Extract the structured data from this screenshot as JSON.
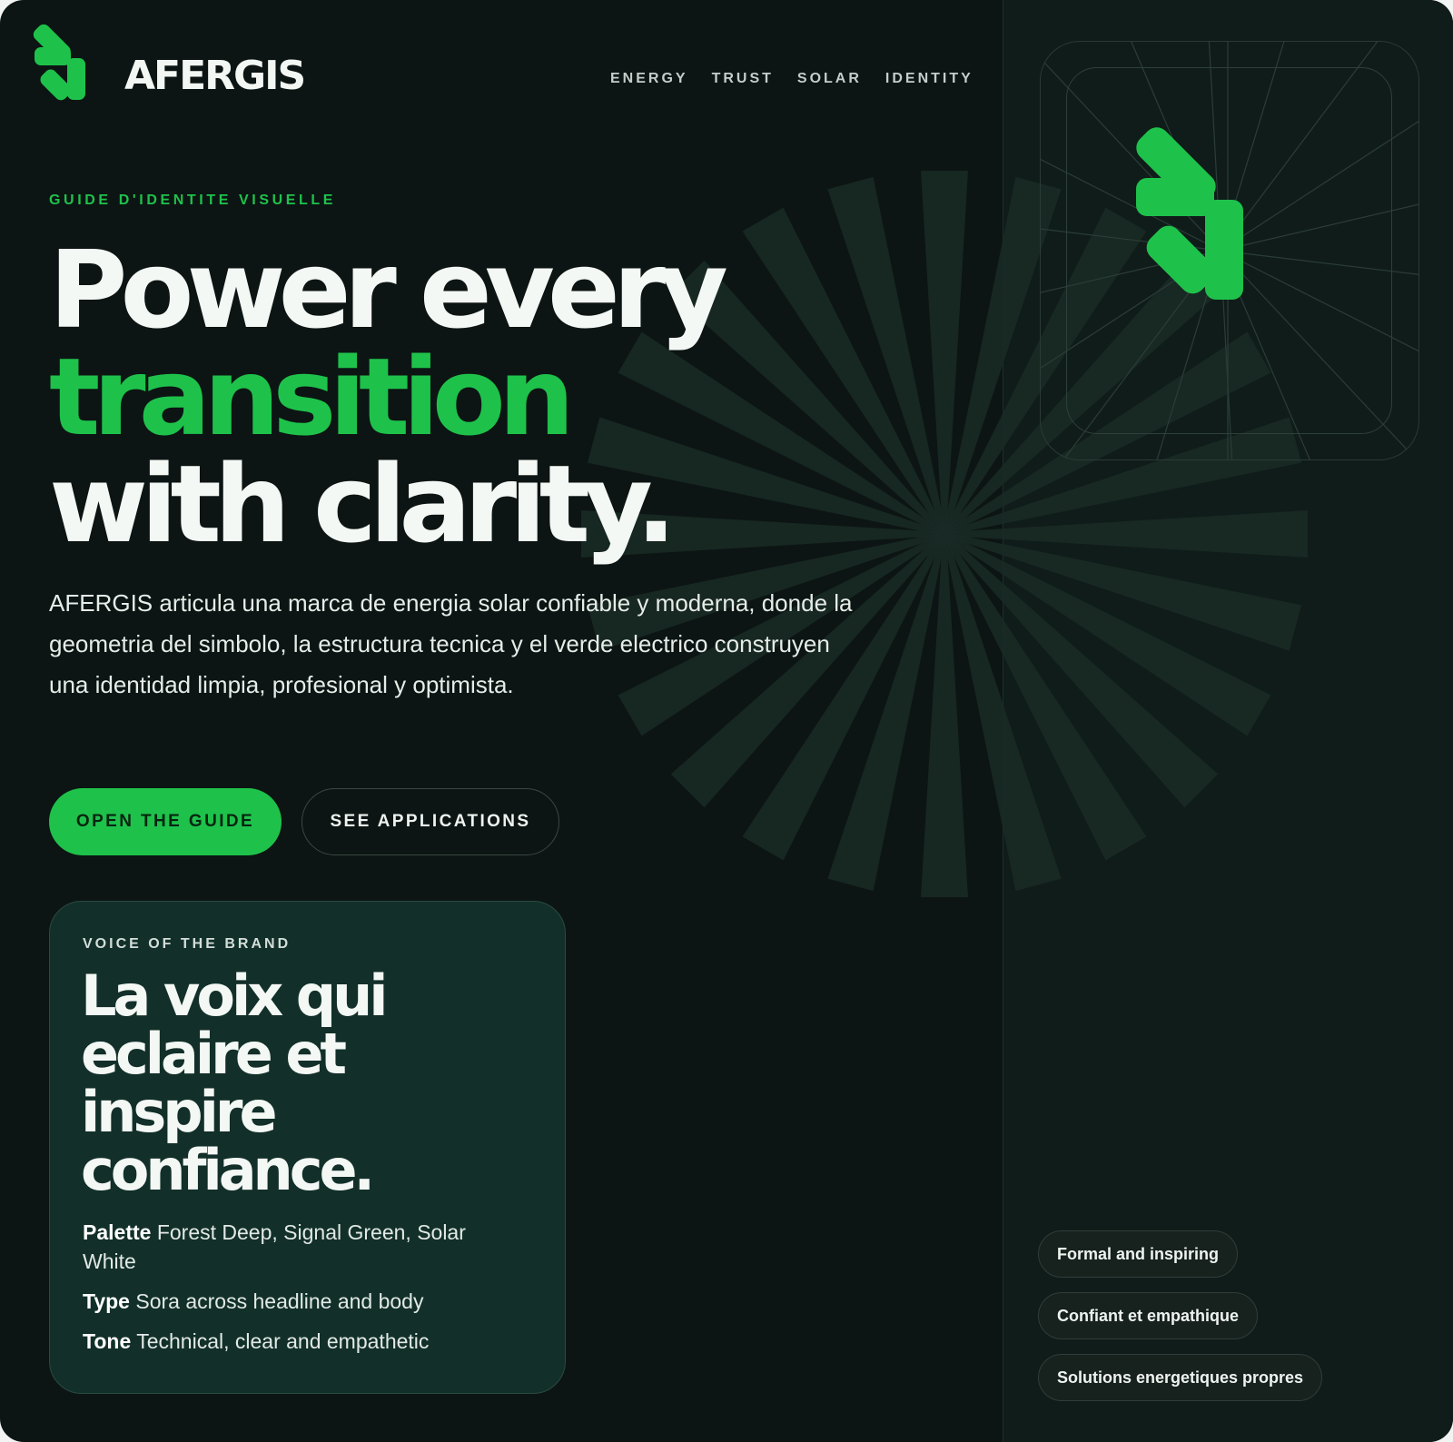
{
  "brand": {
    "name": "AFERGIS",
    "logo_icon": "arrow-symbol-icon"
  },
  "nav": {
    "items": [
      "ENERGY",
      "TRUST",
      "SOLAR",
      "IDENTITY"
    ]
  },
  "hero": {
    "eyebrow": "GUIDE D'IDENTITE VISUELLE",
    "headline": {
      "line1": "Power every",
      "line2": "transition",
      "line3": "with clarity."
    },
    "lead": "AFERGIS articula una marca de energia solar confiable y moderna, donde la geometria del simbolo, la estructura tecnica y el verde electrico construyen una identidad limpia, profesional y optimista.",
    "primary_button": "OPEN THE GUIDE",
    "secondary_button": "SEE APPLICATIONS"
  },
  "voice_card": {
    "eyebrow": "VOICE OF THE BRAND",
    "title": {
      "line1": "La voix qui",
      "line2": "eclaire et",
      "line3": "inspire",
      "line4": "confiance."
    },
    "specs": [
      {
        "label": "Palette",
        "value": "Forest Deep, Signal Green, Solar White"
      },
      {
        "label": "Type",
        "value": "Sora across headline and body"
      },
      {
        "label": "Tone",
        "value": "Technical, clear and empathetic"
      }
    ]
  },
  "tags": [
    "Formal and inspiring",
    "Confiant et empathique",
    "Solutions energetiques propres"
  ],
  "colors": {
    "background": "#0c1513",
    "panel": "#101c19",
    "accent_green": "#1ec24b",
    "card": "#123029",
    "text_light": "#f4f8f5"
  }
}
